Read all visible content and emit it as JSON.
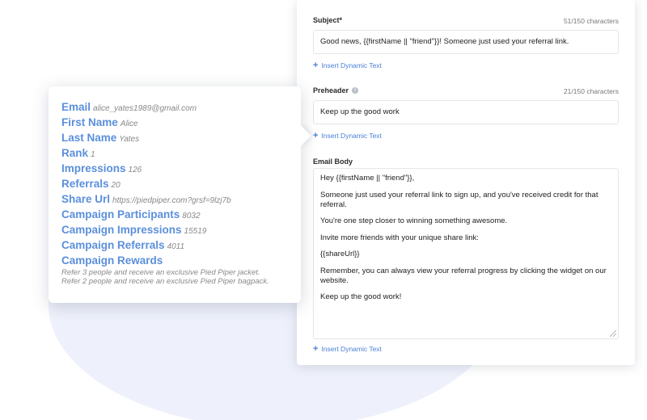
{
  "editor": {
    "subject": {
      "label": "Subject*",
      "count": "51/150 characters",
      "value": "Good news, {{firstName || \"friend\"}}! Someone just used your referral link.",
      "insert_label": "Insert Dynamic Text"
    },
    "preheader": {
      "label": "Preheader",
      "count": "21/150 characters",
      "value": "Keep up the good work",
      "insert_label": "Insert Dynamic Text"
    },
    "body": {
      "label": "Email Body",
      "lines": [
        "Hey {{firstName || \"friend\"}},",
        "Someone just used your referral link to sign up, and you've received credit for that referral.",
        "You're one step closer to winning something awesome.",
        "Invite more friends with your unique share link:",
        "{{shareUrl}}",
        "Remember, you can always view your referral progress by clicking the widget on our website.",
        "Keep up the good work!"
      ],
      "insert_label": "Insert Dynamic Text"
    }
  },
  "variables": {
    "items": [
      {
        "key": "Email",
        "value": "alice_yates1989@gmail.com"
      },
      {
        "key": "First Name",
        "value": "Alice"
      },
      {
        "key": "Last Name",
        "value": "Yates"
      },
      {
        "key": "Rank",
        "value": "1"
      },
      {
        "key": "Impressions",
        "value": "126"
      },
      {
        "key": "Referrals",
        "value": "20"
      },
      {
        "key": "Share Url",
        "value": "https://piedpiper.com?grsf=9lzj7b"
      },
      {
        "key": "Campaign Participants",
        "value": "8032"
      },
      {
        "key": "Campaign Impressions",
        "value": "15519"
      },
      {
        "key": "Campaign Referrals",
        "value": "4011"
      }
    ],
    "rewards": {
      "key": "Campaign Rewards",
      "lines": [
        "Refer 3 people and receive an exclusive Pied Piper jacket.",
        "Refer 2 people and receive an exclusive Pied Piper bagpack."
      ]
    }
  },
  "colors": {
    "accent": "#4a7fd6",
    "variable_key": "#5b8fdc",
    "background_blob": "#eef1fb"
  },
  "icons": {
    "insert": "plus-icon",
    "preheader_info": "info-icon"
  }
}
